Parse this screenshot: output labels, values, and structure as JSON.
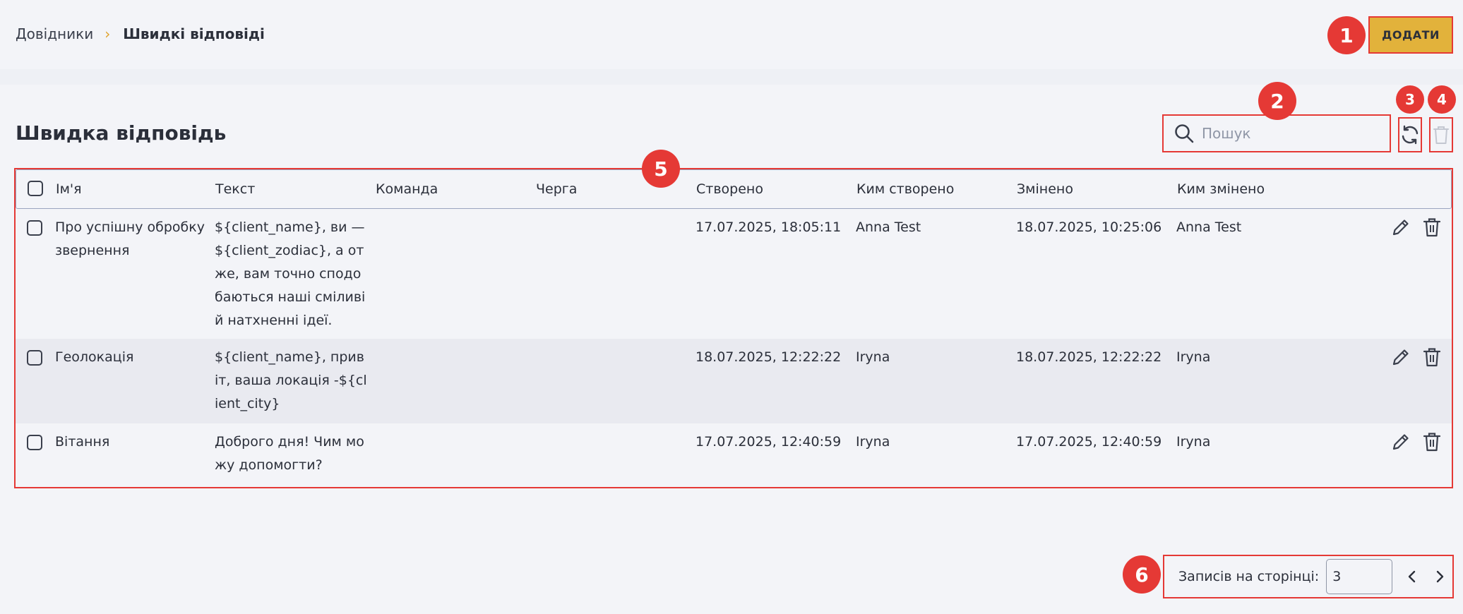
{
  "breadcrumb": {
    "parent": "Довідники",
    "separator": "›",
    "current": "Швидкі відповіді"
  },
  "header": {
    "add_label": "ДОДАТИ"
  },
  "page": {
    "title": "Швидка відповідь"
  },
  "search": {
    "placeholder": "Пошук",
    "value": ""
  },
  "table": {
    "columns": [
      "Ім'я",
      "Текст",
      "Команда",
      "Черга",
      "Створено",
      "Ким створено",
      "Змінено",
      "Ким змінено"
    ],
    "rows": [
      {
        "name": "Про успішну обробку звернення",
        "text": "${client_name}, ви — ${client_zodiac}, а отже, вам точно сподобаються наші сміливі й натхненні ідеї.",
        "team": "",
        "queue": "",
        "created": "17.07.2025, 18:05:11",
        "created_by": "Anna Test",
        "modified": "18.07.2025, 10:25:06",
        "modified_by": "Anna Test"
      },
      {
        "name": "Геолокація",
        "text": "${client_name}, привіт, ваша локація -${client_city}",
        "team": "",
        "queue": "",
        "created": "18.07.2025, 12:22:22",
        "created_by": "Iryna",
        "modified": "18.07.2025, 12:22:22",
        "modified_by": "Iryna"
      },
      {
        "name": "Вітання",
        "text": "Доброго дня! Чим можу допомогти?",
        "team": "",
        "queue": "",
        "created": "17.07.2025, 12:40:59",
        "created_by": "Iryna",
        "modified": "17.07.2025, 12:40:59",
        "modified_by": "Iryna"
      }
    ]
  },
  "pagination": {
    "label": "Записів на сторінці:",
    "per_page": "3"
  },
  "annotations": [
    "1",
    "2",
    "3",
    "4",
    "5",
    "6"
  ],
  "colors": {
    "accent": "#e2b23b",
    "annotation": "#e53935",
    "text": "#2b2f3a",
    "background": "#f3f4f8"
  },
  "icons": [
    "search-icon",
    "refresh-icon",
    "trash-icon",
    "pencil-icon",
    "chevron-left-icon",
    "chevron-right-icon",
    "chevron-right-separator"
  ]
}
